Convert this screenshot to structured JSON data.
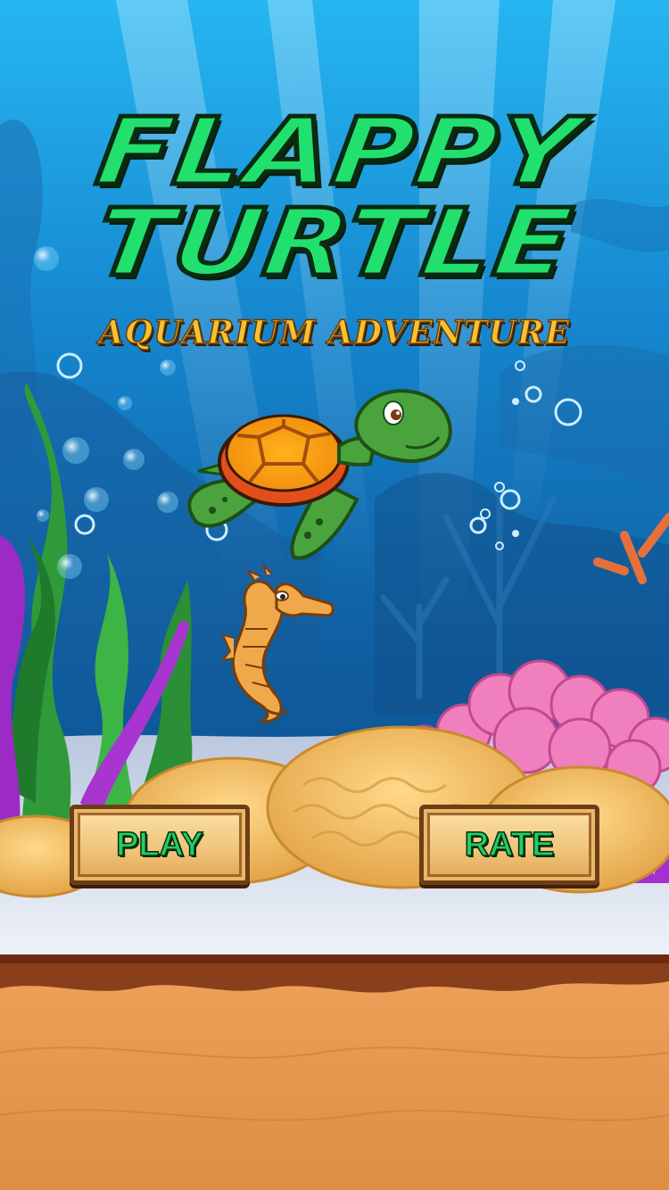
{
  "game": {
    "title_line1": "FLAPPY",
    "title_line2": "TURTLE",
    "subtitle": "AQUARIUM ADVENTURE"
  },
  "menu": {
    "play_label": "PLAY",
    "rate_label": "RATE"
  },
  "colors": {
    "water_top": "#1a9ee6",
    "water_bottom": "#0c4a86",
    "title_green": "#22e06e",
    "subtitle_gold": "#f6c233",
    "sand": "#e69b50",
    "button_face": "#f1c67c",
    "button_border": "#6d3d16"
  },
  "icons": [
    "turtle-icon",
    "seahorse-icon",
    "bubble-icon",
    "seaweed-icon",
    "coral-icon"
  ]
}
